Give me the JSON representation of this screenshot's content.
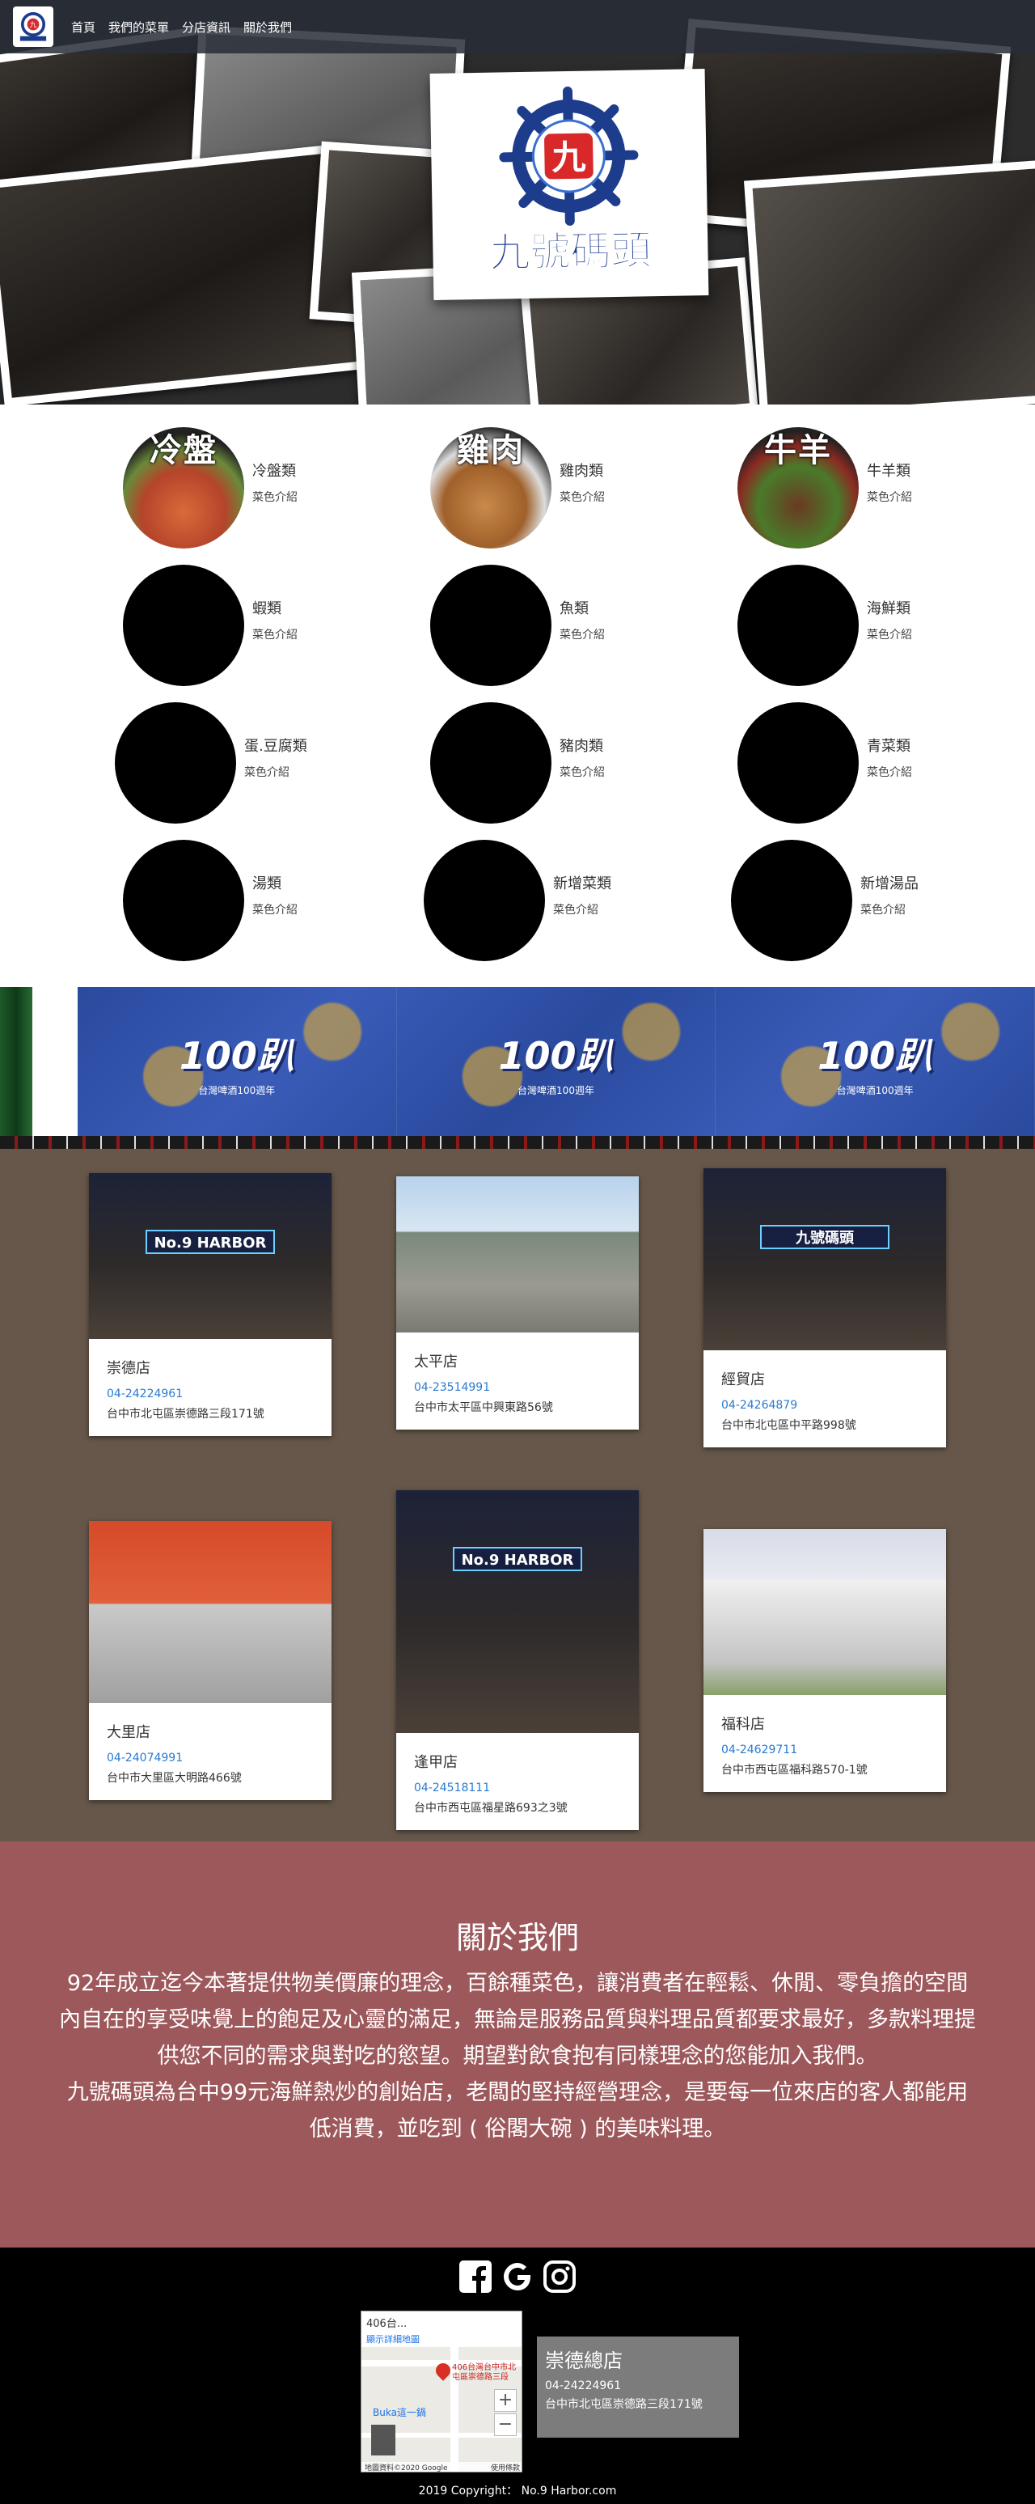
{
  "nav": {
    "links": [
      "首頁",
      "我們的菜單",
      "分店資訊",
      "關於我們"
    ]
  },
  "menu": {
    "items": [
      {
        "name": "冷盤類",
        "sub": "菜色介紹",
        "circle_title": "冷盤"
      },
      {
        "name": "雞肉類",
        "sub": "菜色介紹",
        "circle_title": "雞肉"
      },
      {
        "name": "牛羊類",
        "sub": "菜色介紹",
        "circle_title": "牛羊"
      },
      {
        "name": "蝦類",
        "sub": "菜色介紹",
        "circle_title": ""
      },
      {
        "name": "魚類",
        "sub": "菜色介紹",
        "circle_title": ""
      },
      {
        "name": "海鮮類",
        "sub": "菜色介紹",
        "circle_title": ""
      },
      {
        "name": "蛋.豆腐類",
        "sub": "菜色介紹",
        "circle_title": ""
      },
      {
        "name": "豬肉類",
        "sub": "菜色介紹",
        "circle_title": ""
      },
      {
        "name": "青菜類",
        "sub": "菜色介紹",
        "circle_title": ""
      },
      {
        "name": "湯類",
        "sub": "菜色介紹",
        "circle_title": ""
      },
      {
        "name": "新增菜類",
        "sub": "菜色介紹",
        "circle_title": ""
      },
      {
        "name": "新增湯品",
        "sub": "菜色介紹",
        "circle_title": ""
      }
    ]
  },
  "banner": {
    "headline": "100趴",
    "subline": "台灣啤酒100週年"
  },
  "stores": [
    {
      "name": "崇德店",
      "phone": "04-24224961",
      "address": "台中市北屯區崇德路三段171號"
    },
    {
      "name": "太平店",
      "phone": "04-23514991",
      "address": "台中市太平區中興東路56號"
    },
    {
      "name": "經貿店",
      "phone": "04-24264879",
      "address": "台中市北屯區中平路998號"
    },
    {
      "name": "大里店",
      "phone": "04-24074991",
      "address": "台中市大里區大明路466號"
    },
    {
      "name": "逢甲店",
      "phone": "04-24518111",
      "address": "台中市西屯區福星路693之3號"
    },
    {
      "name": "福科店",
      "phone": "04-24629711",
      "address": "台中市西屯區福科路570-1號"
    }
  ],
  "about": {
    "title": "關於我們",
    "paragraph1": "92年成立迄今本著提供物美價廉的理念，百餘種菜色，讓消費者在輕鬆、休閒、零負擔的空間內自在的享受味覺上的飽足及心靈的滿足，無論是服務品質與料理品質都要求最好，多款料理提供您不同的需求與對吃的慾望。期望對飲食抱有同樣理念的您能加入我們。",
    "paragraph2": "九號碼頭為台中99元海鮮熱炒的創始店，老闆的堅持經營理念，是要每一位來店的客人都能用低消費，並吃到 ( 俗閣大碗 ) 的美味料理。"
  },
  "footer": {
    "social": [
      "facebook-icon",
      "google-icon",
      "instagram-icon"
    ],
    "map": {
      "address_short": "406台...",
      "link": "顯示詳細地圖",
      "place": "406台灣台中市北屯區崇德路三段",
      "store_label": "Buka這一鍋",
      "attribution": "地圖資料©2020 Google",
      "terms": "使用條款"
    },
    "branch": {
      "name": "崇德總店",
      "phone": "04-24224961",
      "address": "台中市北屯區崇德路三段171號"
    },
    "copyright": "2019 Copyright： No.9 Harbor.com"
  },
  "colors": {
    "stores_bg": "#66574a",
    "about_bg": "#9d585b",
    "footer_bg": "#000000",
    "phone_link": "#2a7ad0"
  }
}
